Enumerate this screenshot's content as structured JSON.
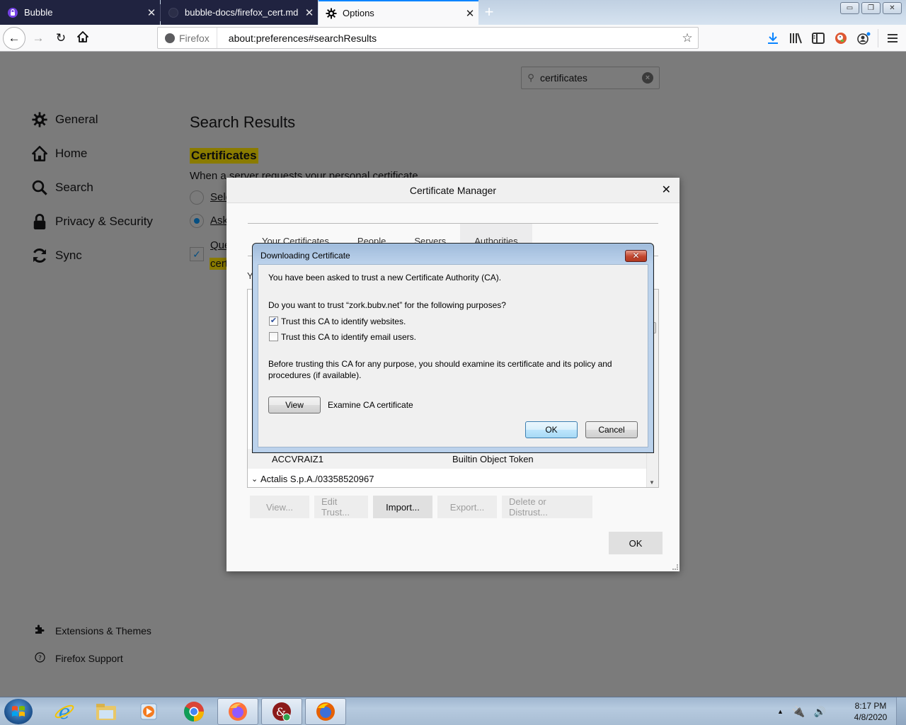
{
  "browser": {
    "tabs": [
      {
        "label": "Bubble",
        "icon": "lock-icon",
        "active": false
      },
      {
        "label": "bubble-docs/firefox_cert.md at",
        "icon": "github-icon",
        "active": false
      },
      {
        "label": "Options",
        "icon": "gear-icon",
        "active": true
      }
    ],
    "tab_close_glyph": "✕",
    "new_tab_glyph": "+",
    "window_controls": {
      "minimize": "▭",
      "restore": "❐",
      "close": "✕"
    },
    "identity_label": "Firefox",
    "url": "about:preferences#searchResults",
    "toolbar_icons": [
      "downloads-icon",
      "library-icon",
      "sidebar-icon",
      "duckduckgo-icon",
      "account-icon",
      "menu-icon"
    ]
  },
  "prefs": {
    "search": {
      "value": "certificates"
    },
    "categories": [
      {
        "label": "General",
        "icon": "gear-icon"
      },
      {
        "label": "Home",
        "icon": "home-icon"
      },
      {
        "label": "Search",
        "icon": "search-icon"
      },
      {
        "label": "Privacy & Security",
        "icon": "lock-icon"
      },
      {
        "label": "Sync",
        "icon": "sync-icon"
      }
    ],
    "footer": [
      {
        "label": "Extensions & Themes",
        "icon": "puzzle-icon"
      },
      {
        "label": "Firefox Support",
        "icon": "help-icon"
      }
    ],
    "heading": "Search Results",
    "section_title": "Certificates",
    "section_desc": "When a server requests your personal certificate",
    "option1_label": "Sele",
    "option2_label": "Ask",
    "option3_label": "Que",
    "option3_highlight": "cert"
  },
  "cert_manager": {
    "title": "Certificate Manager",
    "close_glyph": "✕",
    "tabs": [
      "Your Certificates",
      "People",
      "Servers",
      "Authorities"
    ],
    "active_tab": "Authorities",
    "desc_fragment": "Y",
    "rows": [
      {
        "name": "ACCVRAIZ1",
        "token": "Builtin Object Token"
      },
      {
        "name": "Actalis S.p.A./03358520967",
        "token": "",
        "expander": "⌄"
      }
    ],
    "buttons": [
      {
        "label": "View...",
        "enabled": false
      },
      {
        "label": "Edit Trust...",
        "enabled": false
      },
      {
        "label": "Import...",
        "enabled": true
      },
      {
        "label": "Export...",
        "enabled": false
      },
      {
        "label": "Delete or Distrust...",
        "enabled": false
      }
    ],
    "ok_label": "OK"
  },
  "download_dialog": {
    "title": "Downloading Certificate",
    "close_glyph": "✕",
    "intro": "You have been asked to trust a new Certificate Authority (CA).",
    "question": "Do you want to trust “zork.bubv.net” for the following purposes?",
    "options": [
      {
        "label": "Trust this CA to identify websites.",
        "checked": true
      },
      {
        "label": "Trust this CA to identify email users.",
        "checked": false
      }
    ],
    "warning_line1": "Before trusting this CA for any purpose, you should examine its certificate and its policy and",
    "warning_line2": "procedures (if available).",
    "view_label": "View",
    "view_desc": "Examine CA certificate",
    "ok_label": "OK",
    "cancel_label": "Cancel"
  },
  "taskbar": {
    "apps": [
      "internet-explorer-icon",
      "file-explorer-icon",
      "media-player-icon",
      "chrome-icon",
      "firefox-icon",
      "security-app-icon",
      "firefox-icon"
    ],
    "time": "8:17 PM",
    "date": "4/8/2020"
  },
  "colors": {
    "accent": "#0a84ff",
    "highlight": "#8a7b00",
    "dim_overlay": "#7b7b7b",
    "dark_tab": "#202340"
  }
}
